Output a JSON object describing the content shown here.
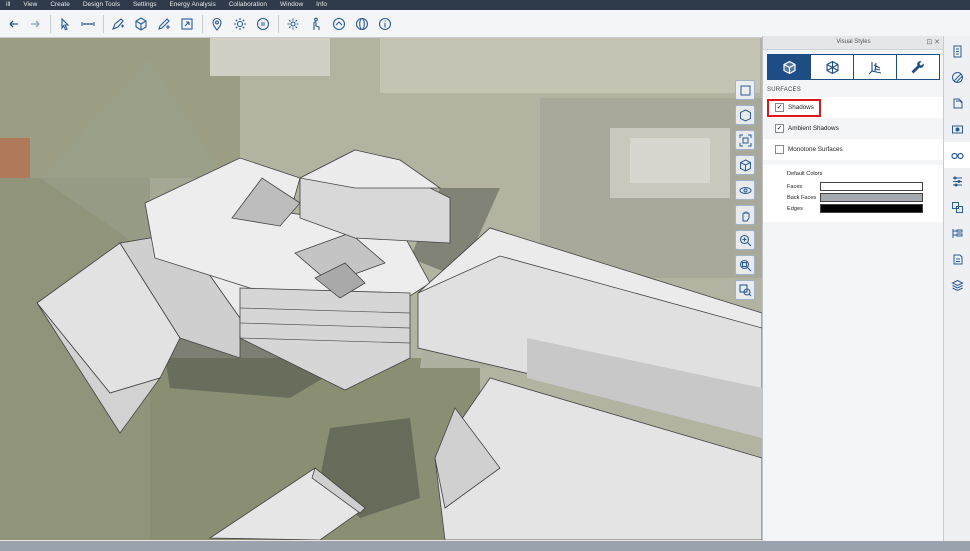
{
  "menu": [
    "ill",
    "View",
    "Create",
    "Design Tools",
    "Settings",
    "Energy Analysis",
    "Collaboration",
    "Window",
    "Info"
  ],
  "toolbar_icons": [
    "undo-icon",
    "redo-icon",
    "select-arrow-icon",
    "measure-icon",
    "draw-pen-icon",
    "solid-box-icon",
    "edit-solid-icon",
    "align-icon",
    "location-pin-icon",
    "sun-icon",
    "time-clock-icon",
    "settings-gear-icon",
    "energy-hand-icon",
    "share-icon",
    "globe-icon",
    "info-icon"
  ],
  "nav_icons": [
    "zoom-extents-icon",
    "view-cube-icon",
    "fit-view-icon",
    "perspective-icon",
    "orbit-icon",
    "pan-hand-icon",
    "zoom-in-icon",
    "zoom-window-icon",
    "zoom-region-icon"
  ],
  "panel": {
    "title": "Visual Styles",
    "header_controls": "⊡ ✕",
    "tabs": [
      {
        "icon": "solid-cube-icon",
        "active": true
      },
      {
        "icon": "wireframe-cube-icon",
        "active": false
      },
      {
        "icon": "axes-grid-icon",
        "active": false
      },
      {
        "icon": "wrench-icon",
        "active": false
      }
    ],
    "section": "SURFACES",
    "options": {
      "shadows": {
        "label": "Shadows",
        "checked": "✓"
      },
      "ambient": {
        "label": "Ambient Shadows",
        "checked": "✓"
      },
      "monotone": {
        "label": "Monotone Surfaces",
        "checked": ""
      }
    },
    "default_colors": {
      "title": "Default Colors",
      "faces": {
        "label": "Faces",
        "color": "#ffffff"
      },
      "back_faces": {
        "label": "Back Faces",
        "color": "#a5aab0"
      },
      "edges": {
        "label": "Edges",
        "color": "#000000"
      }
    }
  },
  "right_strip_icons": [
    "properties-icon",
    "materials-icon",
    "layers-icon",
    "visual-styles-glasses-icon",
    "scene-settings-icon",
    "components-icon",
    "outliner-icon",
    "assets-icon",
    "stack-icon"
  ],
  "colors": {
    "accent": "#1e4d86",
    "highlight": "#e0161f",
    "menubar": "#2f3a4a"
  }
}
